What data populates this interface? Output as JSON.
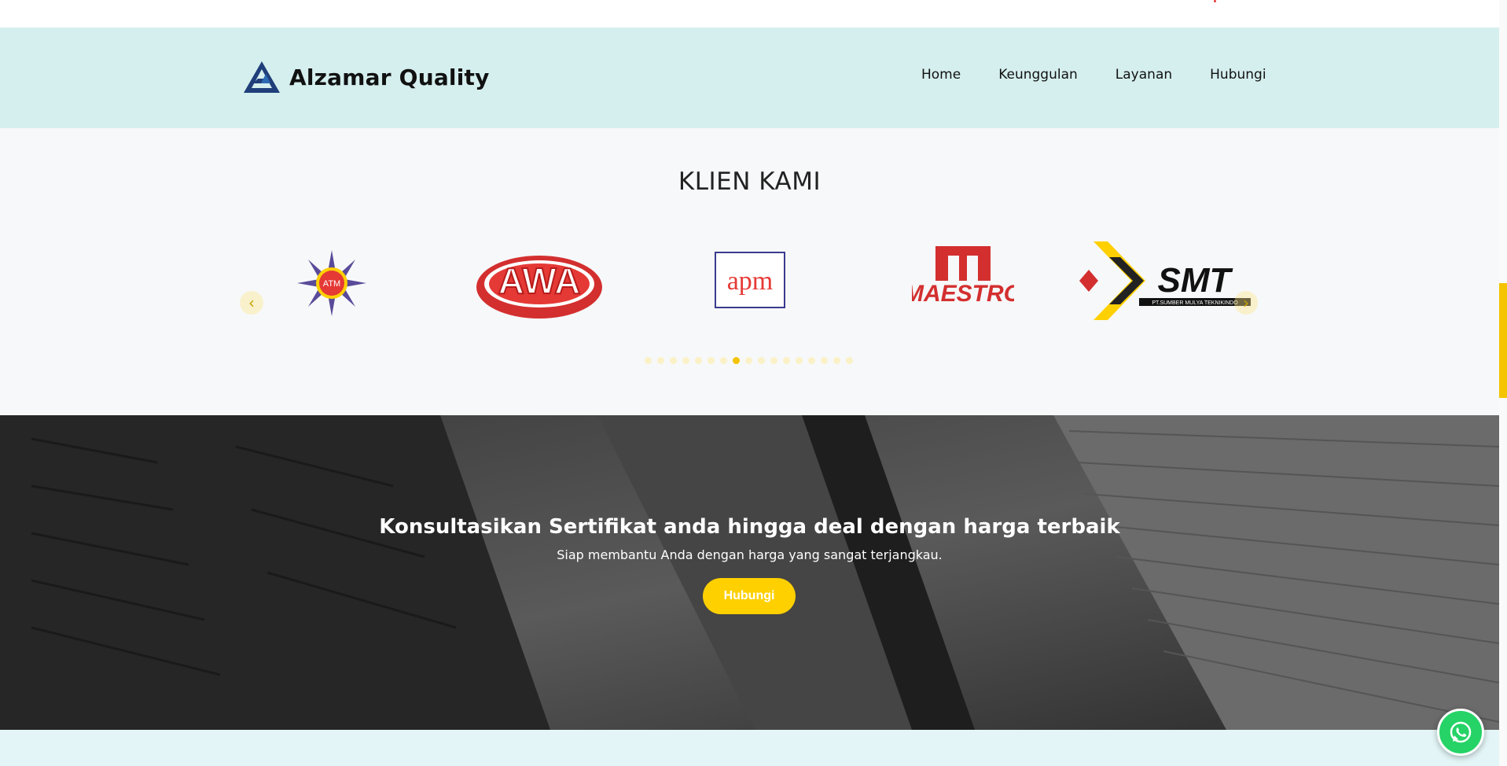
{
  "header": {
    "brand_name": "Alzamar Quality",
    "nav": [
      "Home",
      "Keunggulan",
      "Layanan",
      "Hubungi"
    ]
  },
  "clients": {
    "title": "KLIEN KAMI",
    "logos": [
      {
        "name": "ATM",
        "text": "ATM"
      },
      {
        "name": "AWA",
        "text": "AWA"
      },
      {
        "name": "APM",
        "text": "apm"
      },
      {
        "name": "MAESTRO",
        "text": "MAESTRO"
      },
      {
        "name": "SMT",
        "text": "SMT",
        "subtext": "PT.SUMBER MULYA TEKNIKINDO"
      }
    ],
    "carousel_dots_total": 17,
    "carousel_active_dot": 7
  },
  "cta": {
    "title": "Konsultasikan Sertifikat anda hingga deal dengan harga terbaik",
    "subtitle": "Siap membantu Anda dengan harga yang sangat terjangkau.",
    "button_label": "Hubungi"
  },
  "colors": {
    "accent": "#ffd000",
    "navbar_bg": "#d5efee",
    "whatsapp": "#25d366"
  },
  "icons": {
    "prev": "chevron-left-icon",
    "next": "chevron-right-icon",
    "chat": "whatsapp-icon"
  }
}
